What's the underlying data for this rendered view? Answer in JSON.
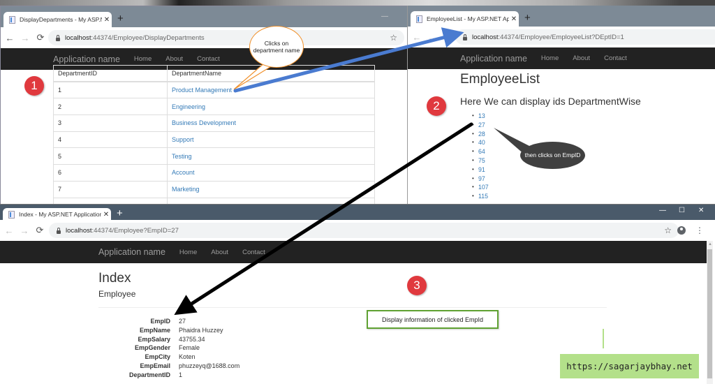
{
  "windows": {
    "departments": {
      "tab_title": "DisplayDepartments - My ASP.NE",
      "url_host": "localhost",
      "url_path": ":44374/Employee/DisplayDepartments",
      "brand": "Application name",
      "nav": [
        "Home",
        "About",
        "Contact"
      ],
      "table": {
        "headers": [
          "DepartmentID",
          "DepartmentName"
        ],
        "rows": [
          {
            "id": "1",
            "name": "Product Management"
          },
          {
            "id": "2",
            "name": "Engineering"
          },
          {
            "id": "3",
            "name": "Business Development"
          },
          {
            "id": "4",
            "name": "Support"
          },
          {
            "id": "5",
            "name": "Testing"
          },
          {
            "id": "6",
            "name": "Account"
          },
          {
            "id": "7",
            "name": "Marketing"
          }
        ]
      }
    },
    "employee_list": {
      "tab_title": "EmployeeList - My ASP.NET Appl",
      "url_host": "localhost",
      "url_path": ":44374/Employee/EmployeeList?DEptID=1",
      "brand": "Application name",
      "nav": [
        "Home",
        "About",
        "Contact"
      ],
      "title": "EmployeeList",
      "subtitle": "Here We can display ids DepartmentWise",
      "ids": [
        "13",
        "27",
        "28",
        "40",
        "64",
        "75",
        "91",
        "97",
        "107",
        "115"
      ]
    },
    "index": {
      "tab_title": "Index - My ASP.NET Application",
      "url_host": "localhost",
      "url_path": ":44374/Employee?EmpID=27",
      "brand": "Application name",
      "nav": [
        "Home",
        "About",
        "Contact"
      ],
      "title": "Index",
      "subtitle": "Employee",
      "details": [
        {
          "label": "EmpID",
          "value": "27"
        },
        {
          "label": "EmpName",
          "value": "Phaidra Huzzey"
        },
        {
          "label": "EmpSalary",
          "value": "43755.34"
        },
        {
          "label": "EmpGender",
          "value": "Female"
        },
        {
          "label": "EmpCity",
          "value": "Koten"
        },
        {
          "label": "EmpEmail",
          "value": "phuzzeyq@1688.com"
        },
        {
          "label": "DepartmentID",
          "value": "1"
        }
      ]
    }
  },
  "annotations": {
    "badges": [
      "1",
      "2",
      "3"
    ],
    "callout_department": "Clicks on department name",
    "callout_empid": "then clicks on EmpID",
    "info_box": "Display information of clicked EmpId",
    "site_url": "https://sagarjaybhay.net"
  },
  "icons": {
    "back": "←",
    "forward": "→",
    "reload": "⟳",
    "star": "☆",
    "close": "✕",
    "new_tab": "+",
    "minimize": "—",
    "maximize": "☐",
    "menu": "⋮"
  },
  "colors": {
    "link": "#337ab7",
    "navbar": "#222222",
    "badge": "#e0393e",
    "arrow_blue": "#4a7bd0",
    "callout_border": "#f0902a",
    "info_border": "#5fa132",
    "url_badge_bg": "#b3e08a"
  }
}
